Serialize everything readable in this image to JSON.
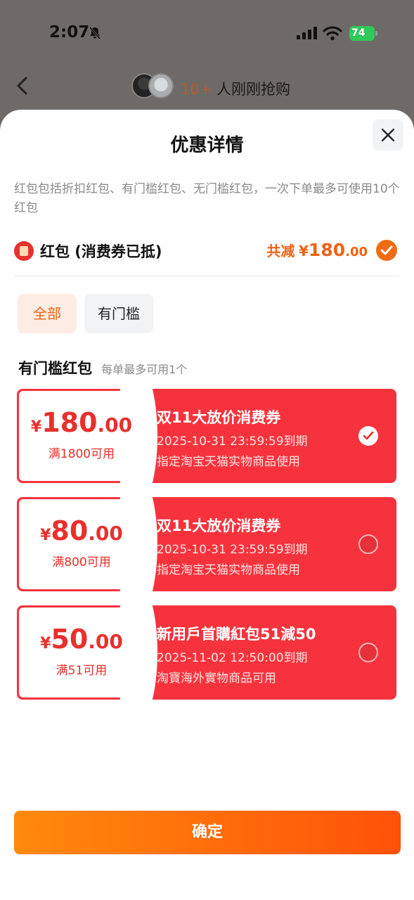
{
  "status_bar": {
    "time": "2:07",
    "battery": "74"
  },
  "header": {
    "buyers_count": "10+",
    "buyers_text": "人刚刚抢购"
  },
  "sheet": {
    "title": "优惠详情",
    "intro": "红包包括折扣红包、有门槛红包、无门槛红包，一次下单最多可使用10个红包",
    "red_packet_label": "红包 (消费券已抵)",
    "total_prefix": "共减",
    "total_currency": "¥",
    "total_integer": "180",
    "total_decimal": ".00",
    "filters": [
      "全部",
      "有门槛"
    ],
    "section_title": "有门槛红包",
    "section_note": "每单最多可用1个",
    "coupons": [
      {
        "currency": "¥",
        "integer": "180",
        "decimal": ".00",
        "condition": "满1800可用",
        "title": "双11大放价消费券",
        "expiry": "2025-10-31 23:59:59到期",
        "scope": "指定淘宝天猫实物商品使用",
        "selected": true
      },
      {
        "currency": "¥",
        "integer": "80",
        "decimal": ".00",
        "condition": "满800可用",
        "title": "双11大放价消费券",
        "expiry": "2025-10-31 23:59:59到期",
        "scope": "指定淘宝天猫实物商品使用",
        "selected": false
      },
      {
        "currency": "¥",
        "integer": "50",
        "decimal": ".00",
        "condition": "满51可用",
        "title": "新用戶首購紅包51減50",
        "expiry": "2025-11-02 12:50:00到期",
        "scope": "淘寶海外實物商品可用",
        "selected": false
      }
    ],
    "confirm_label": "确定"
  },
  "colors": {
    "accent": "#f06215",
    "coupon_red": "#f6333d",
    "confirm_start": "#ff8a0c",
    "confirm_end": "#ff5209"
  }
}
